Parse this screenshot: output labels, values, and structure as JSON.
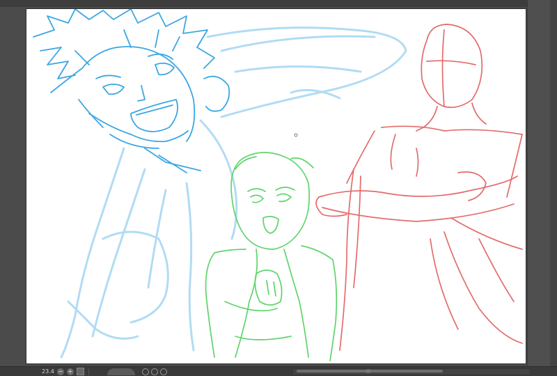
{
  "statusbar": {
    "zoom_value": "23.4",
    "zoom_out_glyph": "−",
    "zoom_in_glyph": "+",
    "grip_glyph": "|||"
  },
  "canvas": {
    "background": "#ffffff",
    "sketch_colors": {
      "blue": "#3aa6e4",
      "light_blue": "#a9d8f3",
      "green": "#5ed46a",
      "red": "#e36b6b"
    }
  },
  "icons": [
    "zoom-out-icon",
    "zoom-in-icon",
    "fit-window-icon",
    "rotate-dial-icon",
    "rotate-left-icon",
    "rotate-right-icon",
    "flip-icon",
    "scroll-grip-icon"
  ]
}
